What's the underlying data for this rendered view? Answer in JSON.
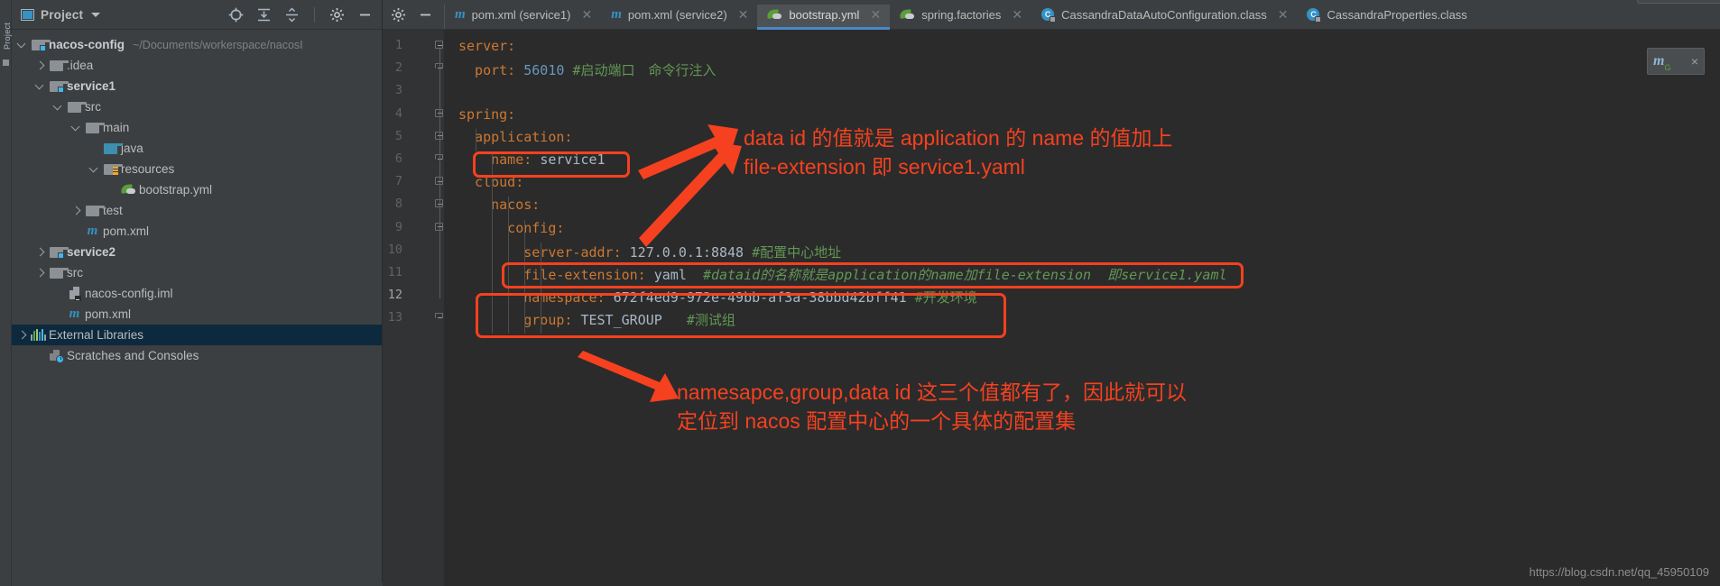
{
  "window": {
    "vertical_tab_label": "Project",
    "watermark": "https://blog.csdn.net/qq_45950109"
  },
  "project_panel": {
    "title": "Project",
    "icons": [
      {
        "name": "locate-icon",
        "glyph": "target"
      },
      {
        "name": "collapse-all-icon",
        "glyph": "collapse"
      },
      {
        "name": "expand-all-icon",
        "glyph": "expand"
      },
      {
        "name": "settings-gear-icon",
        "glyph": "gear"
      },
      {
        "name": "hide-icon",
        "glyph": "minus"
      }
    ],
    "tree": [
      {
        "label": "nacos-config",
        "hint": "~/Documents/workerspace/nacosΙ",
        "icon": "module-folder-icon",
        "indent": 0,
        "arrow": "open",
        "bold": true,
        "selected": false
      },
      {
        "label": ".idea",
        "hint": "",
        "icon": "folder-icon",
        "indent": 1,
        "arrow": "closed",
        "bold": false,
        "selected": false
      },
      {
        "label": "service1",
        "hint": "",
        "icon": "module-folder-icon",
        "indent": 1,
        "arrow": "open",
        "bold": true,
        "selected": false
      },
      {
        "label": "src",
        "hint": "",
        "icon": "folder-icon",
        "indent": 2,
        "arrow": "open",
        "bold": false,
        "selected": false
      },
      {
        "label": "main",
        "hint": "",
        "icon": "folder-icon",
        "indent": 3,
        "arrow": "open",
        "bold": false,
        "selected": false
      },
      {
        "label": "java",
        "hint": "",
        "icon": "source-folder-icon",
        "indent": 4,
        "arrow": "none",
        "bold": false,
        "selected": false
      },
      {
        "label": "resources",
        "hint": "",
        "icon": "resources-folder-icon",
        "indent": 4,
        "arrow": "open",
        "bold": false,
        "selected": false
      },
      {
        "label": "bootstrap.yml",
        "hint": "",
        "icon": "yaml-file-icon",
        "indent": 5,
        "arrow": "none",
        "bold": false,
        "selected": false
      },
      {
        "label": "test",
        "hint": "",
        "icon": "folder-icon",
        "indent": 3,
        "arrow": "closed",
        "bold": false,
        "selected": false
      },
      {
        "label": "pom.xml",
        "hint": "",
        "icon": "maven-file-icon",
        "indent": 3,
        "arrow": "none",
        "bold": false,
        "selected": false
      },
      {
        "label": "service2",
        "hint": "",
        "icon": "module-folder-icon",
        "indent": 1,
        "arrow": "closed",
        "bold": true,
        "selected": false
      },
      {
        "label": "src",
        "hint": "",
        "icon": "folder-icon",
        "indent": 1,
        "arrow": "closed",
        "bold": false,
        "selected": false
      },
      {
        "label": "nacos-config.iml",
        "hint": "",
        "icon": "iml-file-icon",
        "indent": 2,
        "arrow": "none",
        "bold": false,
        "selected": false
      },
      {
        "label": "pom.xml",
        "hint": "",
        "icon": "maven-file-icon",
        "indent": 2,
        "arrow": "none",
        "bold": false,
        "selected": false
      },
      {
        "label": "External Libraries",
        "hint": "",
        "icon": "libraries-icon",
        "indent": 0,
        "arrow": "closed",
        "bold": false,
        "selected": true
      },
      {
        "label": "Scratches and Consoles",
        "hint": "",
        "icon": "scratches-icon",
        "indent": 1,
        "arrow": "none",
        "bold": false,
        "selected": false
      }
    ]
  },
  "editor": {
    "tabs": [
      {
        "label": "pom.xml (service1)",
        "icon": "maven-file-icon",
        "active": false,
        "closable": true
      },
      {
        "label": "pom.xml (service2)",
        "icon": "maven-file-icon",
        "active": false,
        "closable": true
      },
      {
        "label": "bootstrap.yml",
        "icon": "yaml-file-icon",
        "active": true,
        "closable": true
      },
      {
        "label": "spring.factories",
        "icon": "yaml-file-icon",
        "active": false,
        "closable": true
      },
      {
        "label": "CassandraDataAutoConfiguration.class",
        "icon": "class-file-icon",
        "active": false,
        "closable": true
      },
      {
        "label": "CassandraProperties.class",
        "icon": "class-file-icon",
        "active": false,
        "closable": false
      }
    ],
    "line_numbers": [
      "1",
      "2",
      "3",
      "4",
      "5",
      "6",
      "7",
      "8",
      "9",
      "10",
      "11",
      "12",
      "13"
    ],
    "current_line": "12",
    "lines": [
      {
        "n": 1,
        "segments": [
          {
            "t": "server:",
            "c": "k"
          }
        ]
      },
      {
        "n": 2,
        "segments": [
          {
            "t": "  port: ",
            "c": "k"
          },
          {
            "t": "56010",
            "c": "n"
          },
          {
            "t": " ",
            "c": "v"
          },
          {
            "t": "#启动端口　命令行注入",
            "c": "cm"
          }
        ]
      },
      {
        "n": 3,
        "segments": []
      },
      {
        "n": 4,
        "segments": [
          {
            "t": "spring:",
            "c": "k"
          }
        ]
      },
      {
        "n": 5,
        "segments": [
          {
            "t": "  application:",
            "c": "k"
          }
        ]
      },
      {
        "n": 6,
        "segments": [
          {
            "t": "    name: ",
            "c": "k"
          },
          {
            "t": "service1",
            "c": "v"
          }
        ]
      },
      {
        "n": 7,
        "segments": [
          {
            "t": "  cloud:",
            "c": "k"
          }
        ]
      },
      {
        "n": 8,
        "segments": [
          {
            "t": "    nacos:",
            "c": "k"
          }
        ]
      },
      {
        "n": 9,
        "segments": [
          {
            "t": "      config:",
            "c": "k"
          }
        ]
      },
      {
        "n": 10,
        "segments": [
          {
            "t": "        server-addr: ",
            "c": "k"
          },
          {
            "t": "127.0.0.1:8848",
            "c": "v"
          },
          {
            "t": " ",
            "c": "v"
          },
          {
            "t": "#配置中心地址",
            "c": "cm"
          }
        ]
      },
      {
        "n": 11,
        "segments": [
          {
            "t": "        file-extension: ",
            "c": "k"
          },
          {
            "t": "yaml",
            "c": "v"
          },
          {
            "t": "  ",
            "c": "v"
          },
          {
            "t": "#dataid的名称就是application的name加file-extension  即service1.yaml",
            "c": "cm-i"
          }
        ]
      },
      {
        "n": 12,
        "segments": [
          {
            "t": "        namespace: ",
            "c": "k"
          },
          {
            "t": "672f4ed9-972e-49bb-af3a-38bbd42bff41",
            "c": "v"
          },
          {
            "t": " ",
            "c": "v"
          },
          {
            "t": "#开发环境",
            "c": "cm"
          }
        ]
      },
      {
        "n": 13,
        "segments": [
          {
            "t": "        group: ",
            "c": "k"
          },
          {
            "t": "TEST_GROUP",
            "c": "v"
          },
          {
            "t": "   ",
            "c": "v"
          },
          {
            "t": "#测试组",
            "c": "cm"
          }
        ]
      }
    ]
  },
  "float_widget": {
    "label": "m",
    "sub": "G",
    "close": "×"
  },
  "annotations": {
    "accent_color": "#f5411f",
    "top_text": "data id 的值就是 application 的 name 的值加上\nfile-extension 即 service1.yaml",
    "bottom_text": "namesapce,group,data id 这三个值都有了，因此就可以\n定位到 nacos 配置中心的一个具体的配置集"
  }
}
